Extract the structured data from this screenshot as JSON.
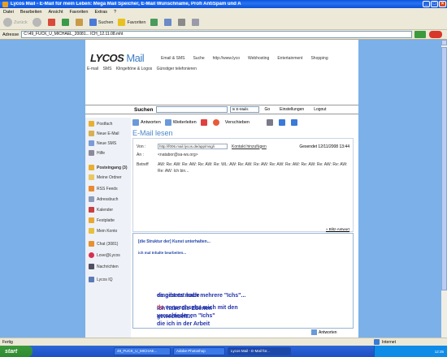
{
  "window": {
    "title": "Lycos Mail - E-Mail für mein Leben: Mega Mail Speicher, E-Mail Wunschname, Profi AntiSpam und A"
  },
  "menu": [
    "Datei",
    "Bearbeiten",
    "Ansicht",
    "Favoriten",
    "Extras",
    "?"
  ],
  "toolbar": {
    "back": "Zurück",
    "search": "Suchen",
    "favorites": "Favoriten"
  },
  "address": {
    "label": "Adresse",
    "value": "C:\\49_FUCK_U_MICHAEL_20081... ICH_12.11.08.mht"
  },
  "lycos": {
    "logo": "LYCOS",
    "logo_suffix": "Mail",
    "topnav": [
      "Email & SMS",
      "Suche",
      "http://www.lyco",
      "Webhosting",
      "Entertainment",
      "Shopping"
    ],
    "subnav": [
      "E-mail",
      "SMS",
      "Klingeltöne & Logos",
      "Günstiger telefonieren"
    ]
  },
  "search": {
    "label": "Suchen",
    "scope": "In E-Mails",
    "go": "Go",
    "settings": "Einstellungen",
    "logout": "Logout"
  },
  "leftnav": [
    "Postfach",
    "Neue E-Mail",
    "Neue SMS",
    "Hilfe",
    "Posteingang (3)",
    "Meine Ordner",
    "RSS Feeds",
    "Adressbuch",
    "Kalender",
    "Festplatte",
    "Mein Konto",
    "Chat (3081)",
    "Love@Lycos",
    "Nachrichten",
    "Lycos IQ"
  ],
  "actions": {
    "reply": "Antworten",
    "forward": "Weiterleiten",
    "move": "Verschieben"
  },
  "mail": {
    "heading": "E-Mail lesen",
    "from_label": "Von :",
    "from_value": "http://f006.mail.lycos.de/app/msg/i",
    "add_contact": "Kontakt hinzufügen",
    "date": "Gesendet 12/11/2008 13:44",
    "to_label": "An :",
    "to_value": "<natabor@sa-ws.org>",
    "subject_label": "Betreff",
    "subject_value": "AW: Re: AW: Re: AW: Re: AW: Re: WL: AW: Re: AW: Re: AW: Re: AW: Re: AW: Re: AW: Re: AW: Re: AW: Re: AW: Ich bin...",
    "quick_reply": "» Blitz-Antwort",
    "link1": "[die Struktur der] Kunst unterhalten...",
    "link2": "ich mal Inhalte bearbeiten...",
    "line1": "da gibt es noch mehrere \"Ichs\"...",
    "line2_red": "du",
    "line2_rest": " verwechselst mich mit den",
    "line3": "verschiedenen \"Ichs\"",
    "line4": "die ich in der Arbeit",
    "line5": "eingesetzt habe",
    "line6": "ich habe die Ebenen",
    "line7": "gewechselt...",
    "bottom_reply": "Antworten"
  },
  "status": {
    "left": "Fertig",
    "zone": "Internet"
  },
  "taskbar": {
    "start": "start",
    "tasks": [
      "49_FUCK_U_MICHAE...",
      "Adobe Photoshop",
      "Lycos Mail - E-Mail für..."
    ],
    "clock": "12:35"
  }
}
